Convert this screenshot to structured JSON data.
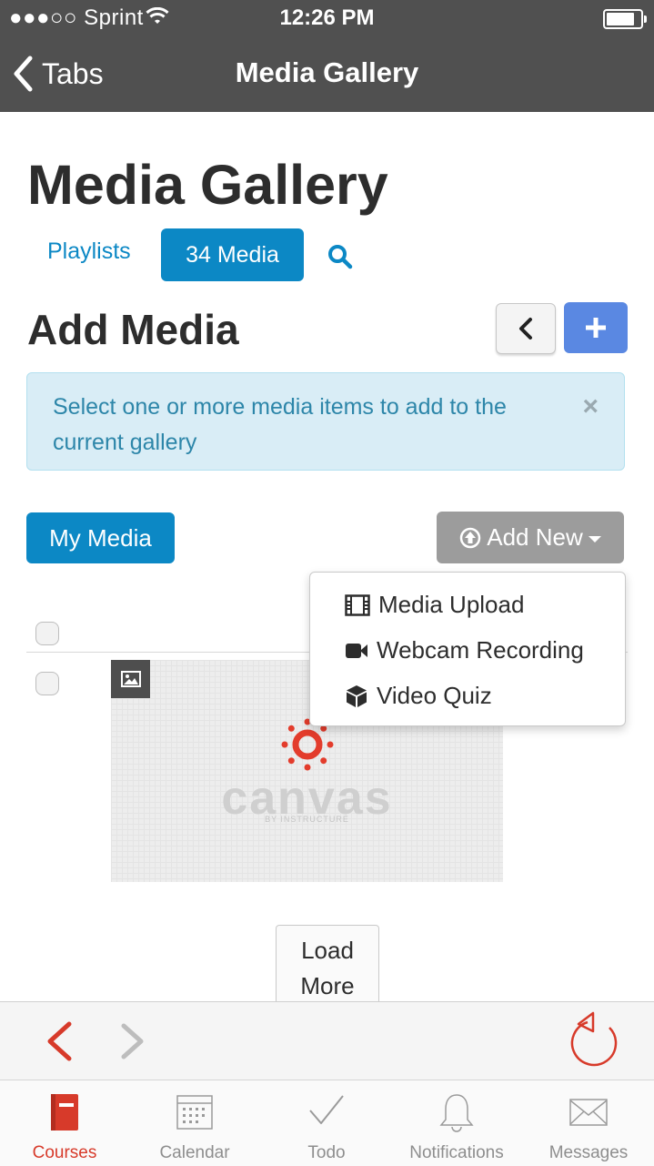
{
  "status_bar": {
    "carrier": "●●●○○ Sprint",
    "time": "12:26 PM"
  },
  "nav": {
    "back_label": "Tabs",
    "title": "Media Gallery"
  },
  "page": {
    "title": "Media Gallery",
    "tabs": {
      "playlists": "Playlists",
      "media": "34 Media"
    },
    "section_title": "Add Media"
  },
  "alert": {
    "message": "Select one or more media items to add to the current gallery",
    "close_glyph": "×"
  },
  "actions": {
    "my_media": "My Media",
    "add_new": "Add New"
  },
  "add_new_menu": {
    "items": [
      {
        "label": "Media Upload",
        "icon": "film-icon"
      },
      {
        "label": "Webcam Recording",
        "icon": "video-camera-icon"
      },
      {
        "label": "Video Quiz",
        "icon": "cube-icon"
      }
    ]
  },
  "media_item": {
    "logo_word": "canvas",
    "logo_sub": "BY INSTRUCTURE"
  },
  "load_more": {
    "line1": "Load",
    "line2": "More"
  },
  "tabbar": {
    "items": [
      {
        "label": "Courses",
        "icon": "courses-icon",
        "active": true
      },
      {
        "label": "Calendar",
        "icon": "calendar-icon"
      },
      {
        "label": "Todo",
        "icon": "check-icon"
      },
      {
        "label": "Notifications",
        "icon": "bell-icon"
      },
      {
        "label": "Messages",
        "icon": "envelope-icon"
      }
    ]
  },
  "colors": {
    "accent_blue": "#0c88c5",
    "add_button_blue": "#5a88e2",
    "alert_bg": "#d9edf6",
    "alert_text": "#2d86a9",
    "nav_bg": "#505050",
    "active_red": "#d73a2a",
    "canvas_red": "#e33c2c"
  }
}
